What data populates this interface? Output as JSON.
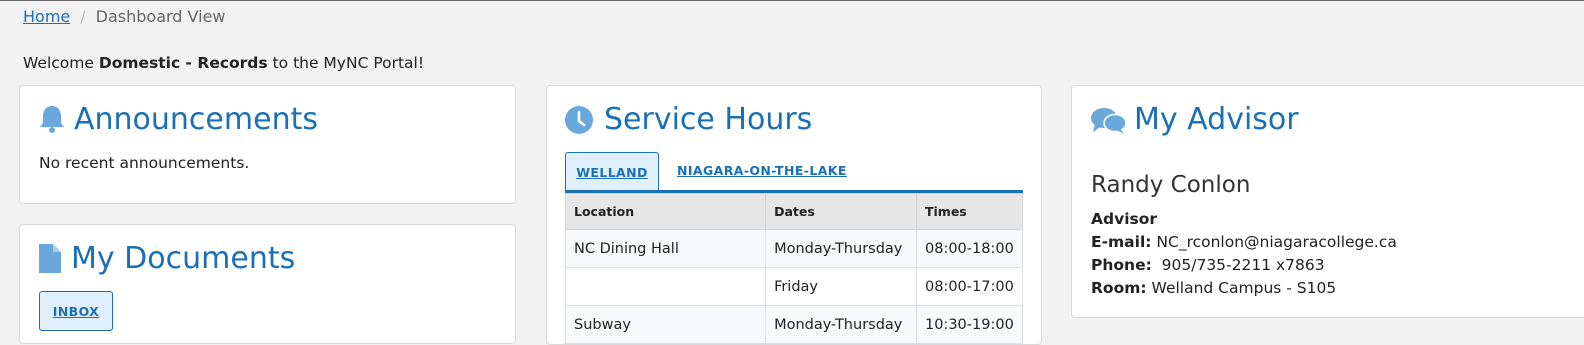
{
  "breadcrumb": {
    "home": "Home",
    "separator": "/",
    "current": "Dashboard View"
  },
  "welcome": {
    "prefix": "Welcome",
    "user": "Domestic - Records",
    "suffix": "to the MyNC Portal!"
  },
  "announcements": {
    "title": "Announcements",
    "icon": "bell-icon",
    "message": "No recent announcements."
  },
  "documents": {
    "title": "My Documents",
    "icon": "document-icon",
    "inbox_label": "INBOX"
  },
  "service_hours": {
    "title": "Service Hours",
    "icon": "clock-icon",
    "tabs": [
      {
        "label": "WELLAND",
        "active": true
      },
      {
        "label": "NIAGARA-ON-THE-LAKE",
        "active": false
      }
    ],
    "columns": [
      "Location",
      "Dates",
      "Times"
    ],
    "rows": [
      [
        "NC Dining Hall",
        "Monday-Thursday",
        "08:00-18:00"
      ],
      [
        "",
        "Friday",
        "08:00-17:00"
      ],
      [
        "Subway",
        "Monday-Thursday",
        "10:30-19:00"
      ]
    ]
  },
  "advisor": {
    "title": "My Advisor",
    "icon": "chat-bubbles-icon",
    "name": "Randy Conlon",
    "role": "Advisor",
    "email_label": "E-mail:",
    "email": "NC_rconlon@niagaracollege.ca",
    "phone_label": "Phone:",
    "phone": "905/735-2211 x7863",
    "room_label": "Room:",
    "room": "Welland Campus - S105"
  },
  "colors": {
    "accent": "#1a6fb5",
    "icon": "#6aa8dc",
    "background": "#f2f2f2"
  }
}
